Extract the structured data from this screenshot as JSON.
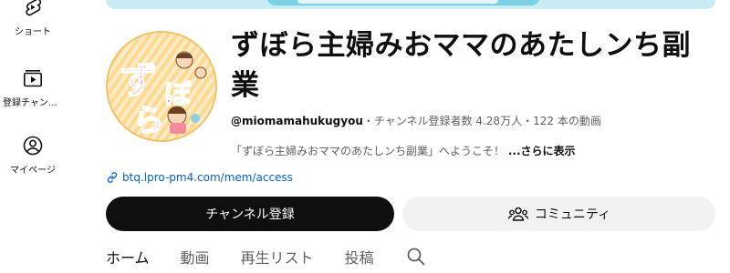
{
  "sidebar": {
    "items": [
      {
        "label": "ショート",
        "icon": "shorts-icon"
      },
      {
        "label": "登録チャンネル",
        "icon": "subscriptions-icon"
      },
      {
        "label": "マイページ",
        "icon": "account-icon"
      }
    ]
  },
  "channel": {
    "avatar_text": [
      "ず",
      "ぼ",
      "ら"
    ],
    "name": "ずぼら主婦みおママのあたしンち副業",
    "handle": "@miomamahukugyou",
    "separator": "・",
    "subscribers": "チャンネル登録者数 4.28万人",
    "video_count": "122 本の動画",
    "description": "「ずぼら主婦みおママのあたしンち副業」へようこそ！",
    "more_label": "...さらに表示",
    "link": "btq.lpro-pm4.com/mem/access"
  },
  "actions": {
    "subscribe_label": "チャンネル登録",
    "community_label": "コミュニティ"
  },
  "tabs": [
    {
      "label": "ホーム",
      "active": true
    },
    {
      "label": "動画",
      "active": false
    },
    {
      "label": "再生リスト",
      "active": false
    },
    {
      "label": "投稿",
      "active": false
    }
  ],
  "colors": {
    "primary_text": "#0f0f0f",
    "secondary_text": "#606060",
    "link": "#065fd4",
    "subscribe_bg": "#0f0f0f",
    "community_bg": "#f2f2f2"
  }
}
